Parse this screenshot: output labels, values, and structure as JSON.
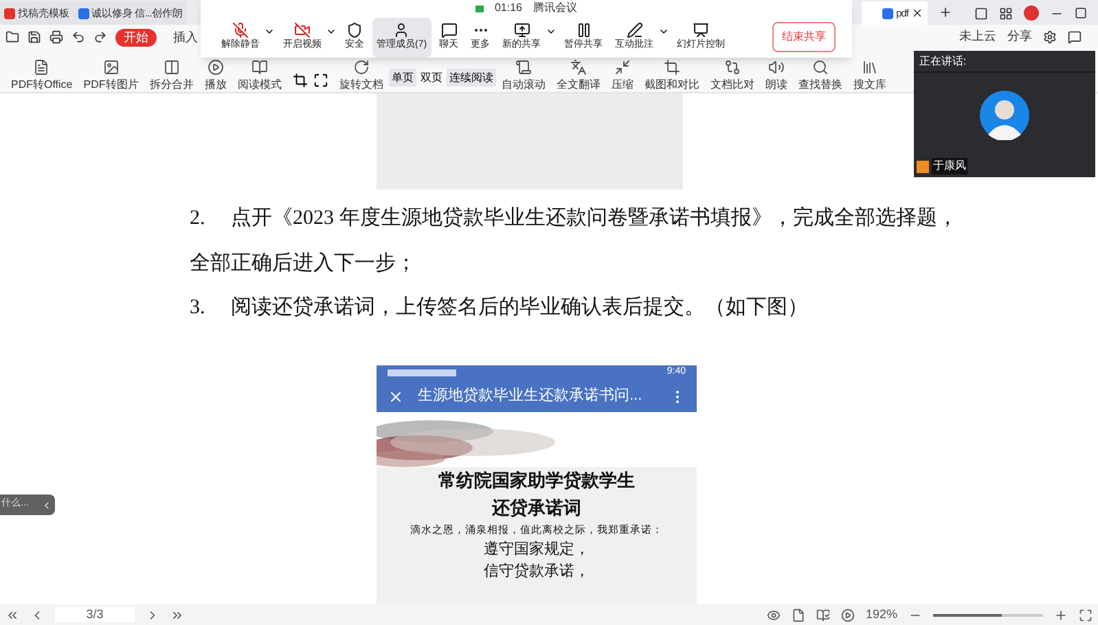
{
  "tabs": [
    {
      "label": "找稿壳模板",
      "selected": false,
      "color": "#e5322d"
    },
    {
      "label": "诚以修身 信...创作朗",
      "selected": false,
      "color": "#2b6fe8"
    },
    {
      "label": "pdf",
      "selected": true,
      "color": "#2b6fe8"
    }
  ],
  "menu": {
    "items": [
      {
        "label": "开始",
        "selected": true
      },
      {
        "label": "插入",
        "selected": false
      }
    ],
    "right": [
      "未上云",
      "分享"
    ]
  },
  "toolbar": {
    "items": [
      {
        "label": "PDF转Office",
        "kind": "office"
      },
      {
        "label": "PDF转图片"
      },
      {
        "label": "拆分合并",
        "kind": "split"
      },
      {
        "label": "播放",
        "kind": "play"
      },
      {
        "label": "阅读模式",
        "kind": "book"
      }
    ],
    "items2": [
      {
        "label": "旋转文档",
        "kind": "rotate"
      }
    ],
    "views": [
      {
        "label": "单页",
        "selected": true
      },
      {
        "label": "双页",
        "selected": false
      },
      {
        "label": "连续阅读",
        "selected": true
      }
    ],
    "items3": [
      {
        "label": "自动滚动",
        "kind": "scroll"
      },
      {
        "label": "全文翻译",
        "kind": "translate"
      },
      {
        "label": "压缩",
        "kind": "compress"
      },
      {
        "label": "截图和对比",
        "kind": "crop"
      },
      {
        "label": "文档比对",
        "kind": "compare"
      },
      {
        "label": "朗读",
        "kind": "read"
      },
      {
        "label": "查找替换",
        "kind": "search"
      },
      {
        "label": "搜文库",
        "kind": "library"
      }
    ]
  },
  "document": {
    "paragraphs": [
      {
        "number": "2.",
        "text": "点开《2023 年度生源地贷款毕业生还款问卷暨承诺书填报》，完成全部选择题，",
        "continuation": "全部正确后进入下一步；"
      },
      {
        "number": "3.",
        "text": "阅读还贷承诺词，上传签名后的毕业确认表后提交。（如下图）"
      }
    ],
    "phone": {
      "time": "9:40",
      "title": "生源地贷款毕业生还款承诺书问...",
      "heading": [
        "常纺院国家助学贷款学生",
        "还贷承诺词"
      ],
      "intro": "滴水之恩，涌泉相报，值此离校之际，我郑重承诺：",
      "lines": [
        "遵守国家规定，",
        "信守贷款承诺，"
      ]
    }
  },
  "meeting": {
    "time": "01:16",
    "title": "腾讯会议",
    "buttons": [
      {
        "label": "解除静音",
        "kind": "mic-off",
        "caret": true,
        "selected": false
      },
      {
        "label": "开启视频",
        "kind": "video-off",
        "caret": true,
        "selected": false
      },
      {
        "label": "安全",
        "kind": "shield",
        "caret": false,
        "selected": false
      },
      {
        "label": "管理成员(7)",
        "kind": "members",
        "caret": false,
        "selected": true
      },
      {
        "label": "聊天",
        "kind": "chat",
        "caret": false,
        "selected": false
      },
      {
        "label": "更多",
        "kind": "more",
        "caret": false,
        "selected": false
      },
      {
        "label": "新的共享",
        "kind": "share",
        "caret": true,
        "selected": false
      },
      {
        "label": "暂停共享",
        "kind": "pause",
        "caret": false,
        "selected": false
      },
      {
        "label": "互动批注",
        "kind": "annotate",
        "caret": true,
        "selected": false
      },
      {
        "label": "幻灯片控制",
        "kind": "slides",
        "caret": false,
        "selected": false
      }
    ],
    "end": "结束共享"
  },
  "speaker": {
    "heading": "正在讲话:",
    "name": "于康风"
  },
  "side_hint": "什么...",
  "status_bar": {
    "page": "3/3",
    "zoom": "192%",
    "level": 0.62
  }
}
